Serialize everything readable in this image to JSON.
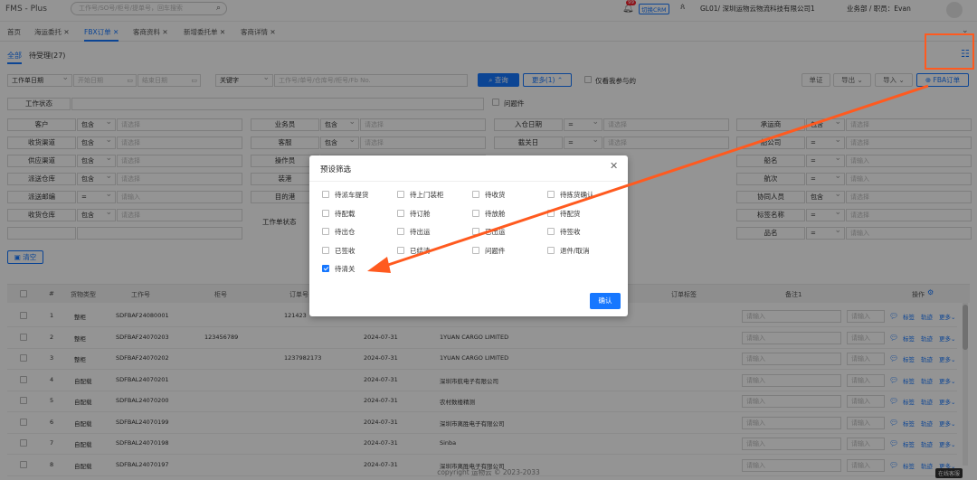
{
  "app": {
    "title": "FMS - Plus",
    "search_placeholder": "工作号/SO号/柜号/提单号，回车搜索",
    "crm_label": "切换CRM",
    "notif_badge": "99",
    "company": "GL01/ 深圳运物云物流科技有限公司1",
    "dept": "业务部 / 职员：Evan"
  },
  "tabs": [
    {
      "label": "首页"
    },
    {
      "label": "海运委托 ✕"
    },
    {
      "label": "FBX订单 ✕"
    },
    {
      "label": "客商资料 ✕"
    },
    {
      "label": "新增委托单 ✕"
    },
    {
      "label": "客商详情 ✕"
    }
  ],
  "subtabs": {
    "all": "全部",
    "pending": "待受理(27)"
  },
  "filters": {
    "date_type": "工作单日期",
    "start_date": "开始日期",
    "end_date": "结束日期",
    "keyword_type": "关键字",
    "keyword_placeholder": "工作号/单号/仓库号/柜号/Fb No.",
    "query": "查询",
    "more": "更多(1)",
    "only_mine": "仅看我参与的",
    "problem": "问题件",
    "work_status": "工作状态"
  },
  "toolbar": {
    "btn1": "单证",
    "export": "导出",
    "import": "导入",
    "fba": "FBA订单"
  },
  "filter_rows": [
    [
      {
        "label": "客户",
        "op": "包含",
        "ph": "请选择"
      },
      {
        "label": "业务员",
        "op": "包含",
        "ph": "请选择"
      },
      {
        "label": "入仓日期",
        "op": "=",
        "ph": "请选择"
      },
      {
        "label": "承运商",
        "op": "包含",
        "ph": "请选择"
      }
    ],
    [
      {
        "label": "收货渠道",
        "op": "包含",
        "ph": "请选择"
      },
      {
        "label": "客服",
        "op": "包含",
        "ph": "请选择"
      },
      {
        "label": "截关日",
        "op": "=",
        "ph": "请选择"
      },
      {
        "label": "船公司",
        "op": "=",
        "ph": "请选择"
      }
    ],
    [
      {
        "label": "供应渠道",
        "op": "包含",
        "ph": "请选择"
      },
      {
        "label": "操作员",
        "op": "",
        "ph": ""
      },
      {
        "label": "",
        "op": "",
        "ph": ""
      },
      {
        "label": "船名",
        "op": "=",
        "ph": "请输入"
      }
    ],
    [
      {
        "label": "派送仓库",
        "op": "包含",
        "ph": "请选择"
      },
      {
        "label": "装港",
        "op": "",
        "ph": ""
      },
      {
        "label": "",
        "op": "",
        "ph": ""
      },
      {
        "label": "航次",
        "op": "=",
        "ph": "请输入"
      }
    ],
    [
      {
        "label": "派送邮编",
        "op": "=",
        "ph": "请输入"
      },
      {
        "label": "目的港",
        "op": "",
        "ph": ""
      },
      {
        "label": "",
        "op": "",
        "ph": ""
      },
      {
        "label": "协同人员",
        "op": "包含",
        "ph": "请选择"
      }
    ],
    [
      {
        "label": "收货仓库",
        "op": "包含",
        "ph": "请选择"
      },
      {
        "label": "",
        "op": "",
        "ph": ""
      },
      {
        "label": "",
        "op": "",
        "ph": ""
      },
      {
        "label": "标签名称",
        "op": "=",
        "ph": "请选择"
      }
    ],
    [
      {
        "label": "",
        "op": "",
        "ph": ""
      },
      {
        "label": "",
        "op": "",
        "ph": ""
      },
      {
        "label": "",
        "op": "",
        "ph": ""
      },
      {
        "label": "品名",
        "op": "=",
        "ph": "请输入"
      }
    ]
  ],
  "work_status_label2": "工作单状态",
  "clear": "清空",
  "table": {
    "headers": [
      "#",
      "货物类型",
      "工作号",
      "柜号",
      "订单号",
      "",
      "",
      "订单标签",
      "备注1",
      "操作"
    ],
    "rows": [
      {
        "n": "1",
        "type": "整柜",
        "job": "SDFBAF24080001",
        "cntr": "",
        "order": "121423",
        "date": "",
        "cust": ""
      },
      {
        "n": "2",
        "type": "整柜",
        "job": "SDFBAF24070203",
        "cntr": "123456789",
        "order": "",
        "date": "2024-07-31",
        "cust": "1YUAN CARGO LIMITED"
      },
      {
        "n": "3",
        "type": "整柜",
        "job": "SDFBAF24070202",
        "cntr": "",
        "order": "1237982173",
        "date": "2024-07-31",
        "cust": "1YUAN CARGO LIMITED"
      },
      {
        "n": "4",
        "type": "自配载",
        "job": "SDFBAL24070201",
        "cntr": "",
        "order": "",
        "date": "2024-07-31",
        "cust": "深圳市航电子有限公司"
      },
      {
        "n": "5",
        "type": "自配载",
        "job": "SDFBAL24070200",
        "cntr": "",
        "order": "",
        "date": "2024-07-31",
        "cust": "农村数楼精测"
      },
      {
        "n": "6",
        "type": "自配载",
        "job": "SDFBAL24070199",
        "cntr": "",
        "order": "",
        "date": "2024-07-31",
        "cust": "深圳市离胜电子有限公司"
      },
      {
        "n": "7",
        "type": "自配载",
        "job": "SDFBAL24070198",
        "cntr": "",
        "order": "",
        "date": "2024-07-31",
        "cust": "Sinba"
      },
      {
        "n": "8",
        "type": "自配载",
        "job": "SDFBAL24070197",
        "cntr": "",
        "order": "",
        "date": "2024-07-31",
        "cust": "深圳市离胜电子有限公司"
      }
    ],
    "input_ph": "请输入",
    "act_label": "标签",
    "act_track": "轨迹",
    "act_more": "更多"
  },
  "footer": "copyright 运物云 © 2023-2033",
  "online": "在线客服",
  "modal": {
    "title": "预设筛选",
    "options": [
      {
        "label": "待派车提货",
        "checked": false
      },
      {
        "label": "待上门装柜",
        "checked": false
      },
      {
        "label": "待收货",
        "checked": false
      },
      {
        "label": "待拣货确认",
        "checked": false
      },
      {
        "label": "待配载",
        "checked": false
      },
      {
        "label": "待订舱",
        "checked": false
      },
      {
        "label": "待放舱",
        "checked": false
      },
      {
        "label": "待配货",
        "checked": false
      },
      {
        "label": "待出仓",
        "checked": false
      },
      {
        "label": "待出运",
        "checked": false
      },
      {
        "label": "已出运",
        "checked": false
      },
      {
        "label": "待签收",
        "checked": false
      },
      {
        "label": "已签收",
        "checked": false
      },
      {
        "label": "已结清",
        "checked": false
      },
      {
        "label": "问题件",
        "checked": false
      },
      {
        "label": "退件/取消",
        "checked": false
      },
      {
        "label": "待清关",
        "checked": true
      }
    ],
    "confirm": "确认"
  },
  "colors": {
    "accent": "#1677ff",
    "annotation": "#ff5a1f"
  }
}
